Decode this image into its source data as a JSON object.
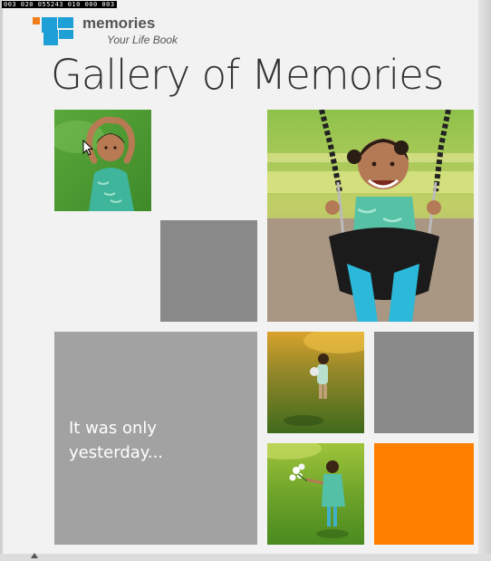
{
  "counter": "003 020 055243 010 000 003",
  "header": {
    "brand": "memories",
    "tagline": "Your Life Book",
    "title": "Gallery of Memories"
  },
  "tiles": {
    "text_tile": "It was only yesterday..."
  },
  "colors": {
    "accent_orange": "#ff8000",
    "tile_grey": "#898989",
    "text_tile_grey": "#a2a2a2",
    "logo_blue": "#1e9fd6",
    "logo_orange": "#f07d1a"
  }
}
